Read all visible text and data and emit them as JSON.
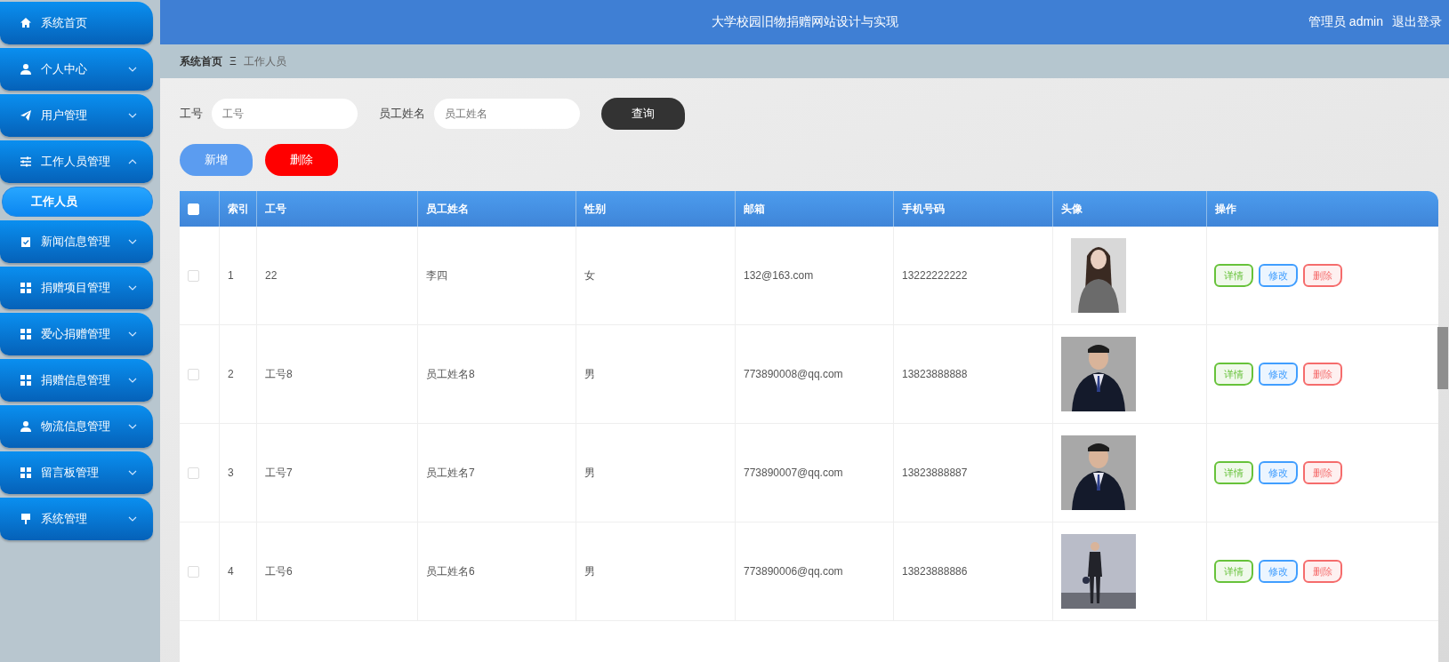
{
  "header": {
    "title": "大学校园旧物捐赠网站设计与实现",
    "user": "管理员 admin",
    "logout": "退出登录"
  },
  "sidebar": {
    "items": [
      {
        "label": "系统首页"
      },
      {
        "label": "个人中心",
        "expanded": false
      },
      {
        "label": "用户管理",
        "expanded": false
      },
      {
        "label": "工作人员管理",
        "expanded": true,
        "children": [
          {
            "label": "工作人员",
            "selected": true
          }
        ]
      },
      {
        "label": "新闻信息管理",
        "expanded": false
      },
      {
        "label": "捐赠项目管理",
        "expanded": false
      },
      {
        "label": "爱心捐赠管理",
        "expanded": false
      },
      {
        "label": "捐赠信息管理",
        "expanded": false
      },
      {
        "label": "物流信息管理",
        "expanded": false
      },
      {
        "label": "留言板管理",
        "expanded": false
      },
      {
        "label": "系统管理",
        "expanded": false
      }
    ]
  },
  "breadcrumb": {
    "home": "系统首页",
    "separator": "Ξ",
    "current": "工作人员"
  },
  "search": {
    "fields": [
      {
        "label": "工号",
        "placeholder": "工号"
      },
      {
        "label": "员工姓名",
        "placeholder": "员工姓名"
      }
    ],
    "button": "查询"
  },
  "actions": {
    "add": "新增",
    "delete": "删除"
  },
  "table": {
    "select_all_checked": false,
    "columns": [
      "索引",
      "工号",
      "员工姓名",
      "性别",
      "邮箱",
      "手机号码",
      "头像",
      "操作"
    ],
    "rows": [
      {
        "selected": false,
        "index": "1",
        "id": "22",
        "name": "李四",
        "gender": "女",
        "email": "132@163.com",
        "phone": "13222222222",
        "avatar": {
          "kind": "picture"
        },
        "ops": [
          "详情",
          "修改",
          "删除"
        ]
      },
      {
        "selected": false,
        "index": "2",
        "id": "工号8",
        "name": "员工姓名8",
        "gender": "男",
        "email": "773890008@qq.com",
        "phone": "13823888888",
        "avatar": {
          "kind": "picture"
        },
        "ops": [
          "详情",
          "修改",
          "删除"
        ]
      },
      {
        "selected": false,
        "index": "3",
        "id": "工号7",
        "name": "员工姓名7",
        "gender": "男",
        "email": "773890007@qq.com",
        "phone": "13823888887",
        "avatar": {
          "kind": "picture"
        },
        "ops": [
          "详情",
          "修改",
          "删除"
        ]
      },
      {
        "selected": false,
        "index": "4",
        "id": "工号6",
        "name": "员工姓名6",
        "gender": "男",
        "email": "773890006@qq.com",
        "phone": "13823888886",
        "avatar": {
          "kind": "picture"
        },
        "ops": [
          "详情",
          "修改",
          "删除"
        ]
      }
    ]
  }
}
